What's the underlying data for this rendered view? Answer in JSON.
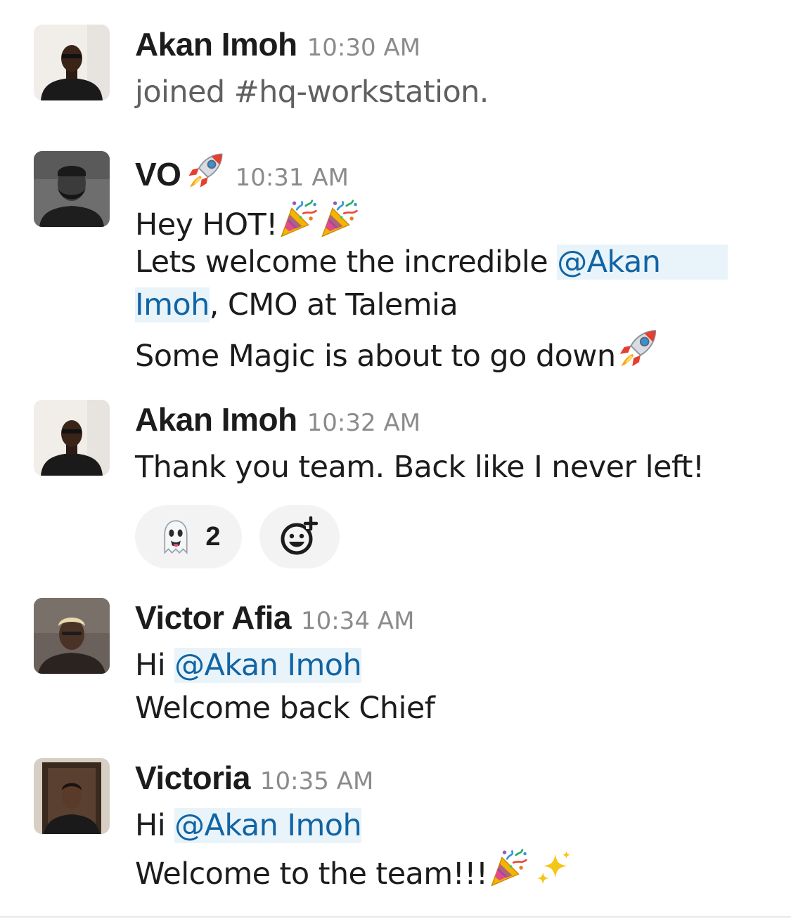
{
  "messages": [
    {
      "author": "Akan Imoh",
      "time": "10:30 AM",
      "avatar": "avatar-akan-imoh",
      "lines": [
        "joined #hq-workstation."
      ]
    },
    {
      "author": "VO",
      "author_emoji": "rocket-emoji",
      "time": "10:31 AM",
      "avatar": "avatar-vo",
      "lines": {
        "l1": "Hey HOT!",
        "l2_pre": "Lets welcome the incredible ",
        "l2_mention": "@Akan",
        "l3_mention": "Imoh",
        "l3_post": ", CMO at Talemia",
        "l4": "Some Magic is about to go down"
      }
    },
    {
      "author": "Akan Imoh",
      "time": "10:32 AM",
      "avatar": "avatar-akan-imoh",
      "lines": [
        "Thank you team. Back like I never left!"
      ],
      "reactions": [
        {
          "emoji": "ghost-emoji",
          "count": "2"
        }
      ]
    },
    {
      "author": "Victor Afia",
      "time": "10:34 AM",
      "avatar": "avatar-victor-afia",
      "lines": {
        "l1_pre": "Hi ",
        "l1_mention": "@Akan Imoh",
        "l2": "Welcome back Chief"
      }
    },
    {
      "author": "Victoria",
      "time": "10:35 AM",
      "avatar": "avatar-victoria",
      "lines": {
        "l1_pre": "Hi ",
        "l1_mention": "@Akan Imoh",
        "l2": "Welcome to the team!!!"
      }
    }
  ],
  "colors": {
    "mention_text": "#1264a3",
    "mention_bg": "#e8f4fa",
    "timestamp": "#8b8b8d",
    "reaction_bg": "#f3f3f3"
  }
}
